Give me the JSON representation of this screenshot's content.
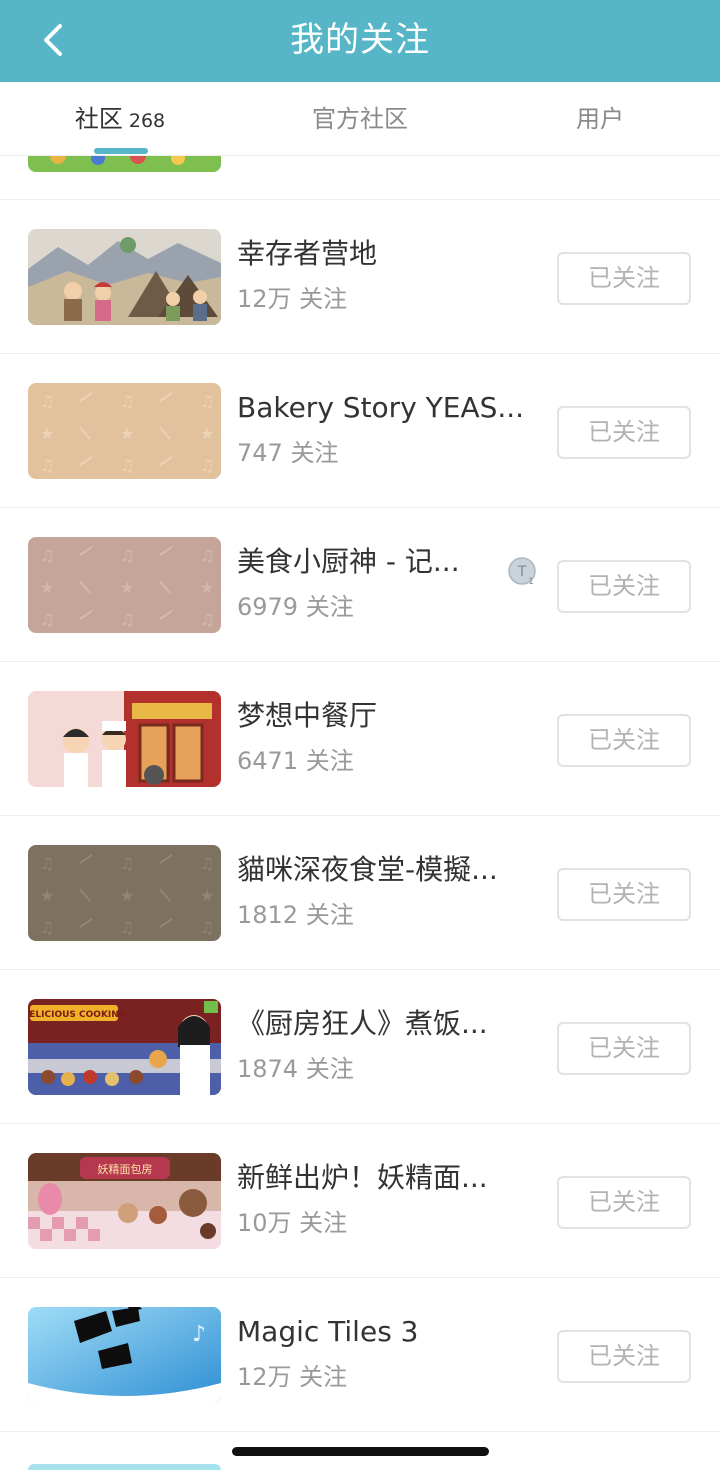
{
  "header": {
    "title": "我的关注",
    "back_icon": "chevron-left-icon",
    "background": "#56b5c6"
  },
  "tabs": [
    {
      "label": "社区",
      "count": "268",
      "active": true
    },
    {
      "label": "官方社区",
      "count": "",
      "active": false
    },
    {
      "label": "用户",
      "count": "",
      "active": false
    }
  ],
  "accent_color": "#56b5c6",
  "communities": [
    {
      "name": "幸存者营地",
      "followers": "12万 关注",
      "button": "已关注",
      "thumb": "survivor-camp-thumbnail"
    },
    {
      "name": "Bakery Story YEAS...",
      "followers": "747 关注",
      "button": "已关注",
      "thumb": "placeholder-pattern-thumbnail"
    },
    {
      "name": "美食小厨神 - 记...",
      "followers": "6979 关注",
      "button": "已关注",
      "thumb": "placeholder-pattern-thumbnail"
    },
    {
      "name": "梦想中餐厅",
      "followers": "6471 关注",
      "button": "已关注",
      "thumb": "dream-restaurant-thumbnail"
    },
    {
      "name": "貓咪深夜食堂-模擬...",
      "followers": "1812 关注",
      "button": "已关注",
      "thumb": "placeholder-pattern-thumbnail"
    },
    {
      "name": "《厨房狂人》煮饭...",
      "followers": "1874 关注",
      "button": "已关注",
      "thumb": "delicious-cooking-thumbnail",
      "thumb_text": "DELICIOUS COOKING"
    },
    {
      "name": "新鲜出炉！妖精面...",
      "followers": "10万 关注",
      "button": "已关注",
      "thumb": "fairy-bakery-thumbnail",
      "thumb_text": "妖精面包房"
    },
    {
      "name": "Magic Tiles 3",
      "followers": "12万 关注",
      "button": "已关注",
      "thumb": "magic-tiles-thumbnail"
    }
  ]
}
